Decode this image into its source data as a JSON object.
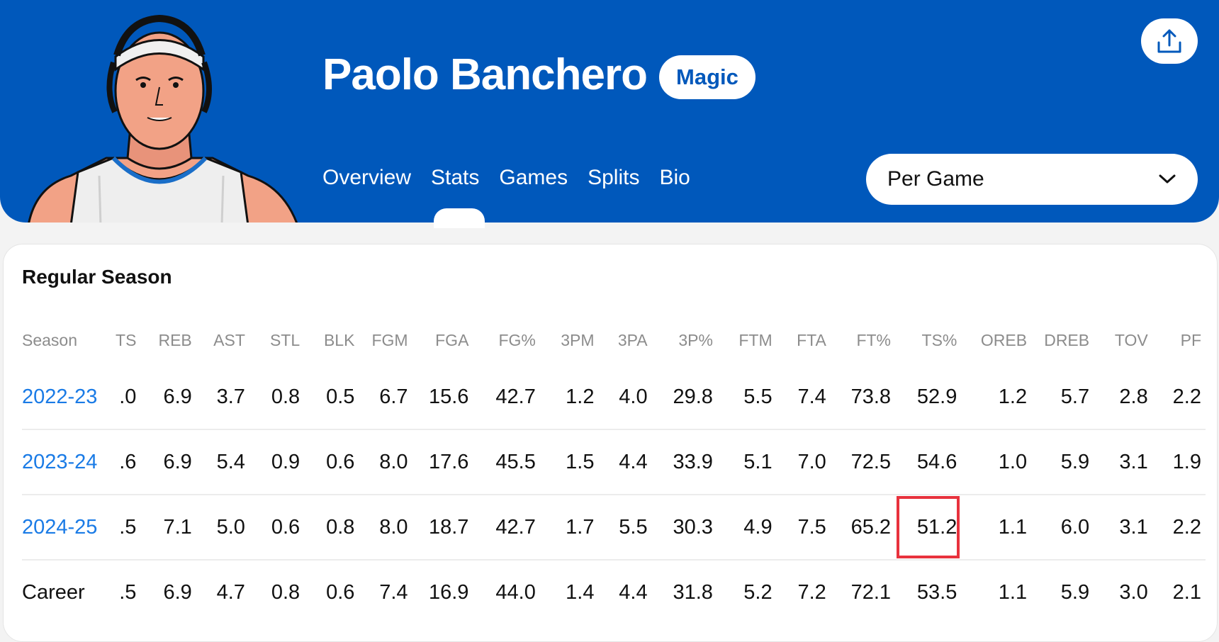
{
  "header": {
    "player_name": "Paolo Banchero",
    "team": "Magic",
    "background_color": "#0058bb",
    "share_icon": "share-upload-icon",
    "nav_tabs": [
      "Overview",
      "Stats",
      "Games",
      "Splits",
      "Bio"
    ],
    "active_tab": "Stats",
    "stat_mode": "Per Game"
  },
  "stats": {
    "section_title": "Regular Season",
    "columns": [
      "Season",
      "TS",
      "REB",
      "AST",
      "STL",
      "BLK",
      "FGM",
      "FGA",
      "FG%",
      "3PM",
      "3PA",
      "3P%",
      "FTM",
      "FTA",
      "FT%",
      "TS%",
      "OREB",
      "DREB",
      "TOV",
      "PF"
    ],
    "rows": [
      [
        "2022-23",
        ".0",
        "6.9",
        "3.7",
        "0.8",
        "0.5",
        "6.7",
        "15.6",
        "42.7",
        "1.2",
        "4.0",
        "29.8",
        "5.5",
        "7.4",
        "73.8",
        "52.9",
        "1.2",
        "5.7",
        "2.8",
        "2.2"
      ],
      [
        "2023-24",
        ".6",
        "6.9",
        "5.4",
        "0.9",
        "0.6",
        "8.0",
        "17.6",
        "45.5",
        "1.5",
        "4.4",
        "33.9",
        "5.1",
        "7.0",
        "72.5",
        "54.6",
        "1.0",
        "5.9",
        "3.1",
        "1.9"
      ],
      [
        "2024-25",
        ".5",
        "7.1",
        "5.0",
        "0.6",
        "0.8",
        "8.0",
        "18.7",
        "42.7",
        "1.7",
        "5.5",
        "30.3",
        "4.9",
        "7.5",
        "65.2",
        "51.2",
        "1.1",
        "6.0",
        "3.1",
        "2.2"
      ],
      [
        "Career",
        ".5",
        "6.9",
        "4.7",
        "0.8",
        "0.6",
        "7.4",
        "16.9",
        "44.0",
        "1.4",
        "4.4",
        "31.8",
        "5.2",
        "7.2",
        "72.1",
        "53.5",
        "1.1",
        "5.9",
        "3.0",
        "2.1"
      ]
    ],
    "highlight_color": "#e8323d"
  }
}
